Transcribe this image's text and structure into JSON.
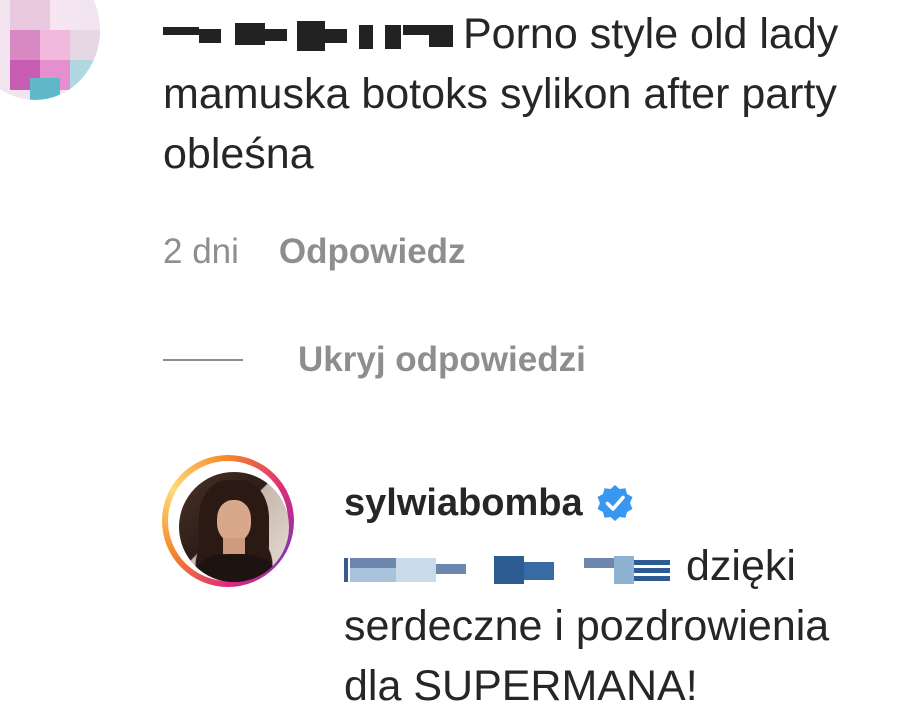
{
  "comment": {
    "text": "Porno style old lady mamuska botoks sylikon after party obleśna",
    "time": "2 dni",
    "reply_label": "Odpowiedz"
  },
  "replies_toggle": {
    "label": "Ukryj odpowiedzi"
  },
  "reply": {
    "username": "sylwiabomba",
    "verified": true,
    "text": "dzięki serdeczne i pozdrowienia dla SUPERMANA!"
  },
  "colors": {
    "text": "#262626",
    "meta": "#8e8e8e",
    "verified_blue": "#3897f0"
  }
}
